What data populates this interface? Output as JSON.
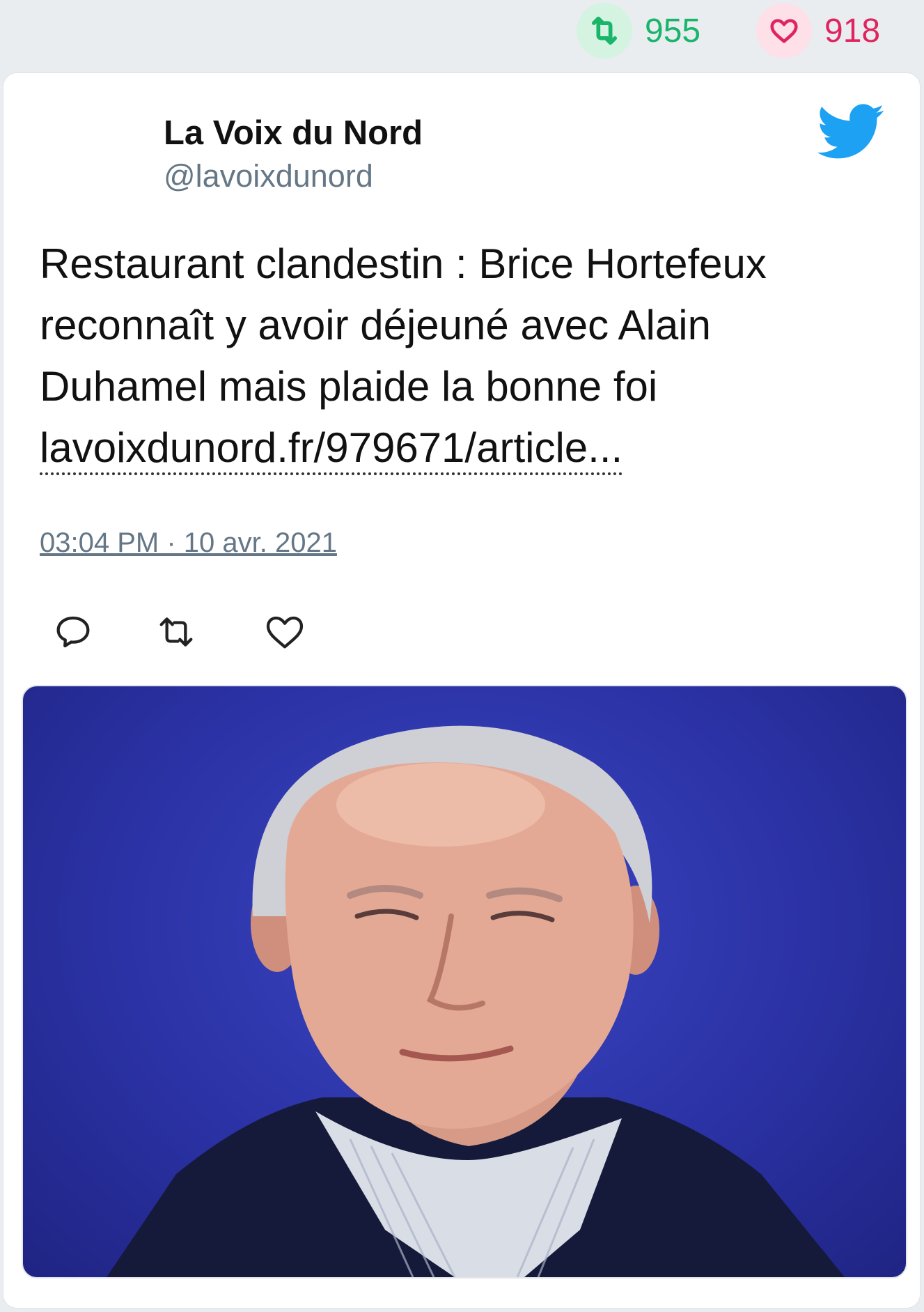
{
  "stats": {
    "retweets": "955",
    "likes": "918",
    "retweet_icon": "retweet-icon",
    "like_icon": "heart-icon",
    "retweet_color": "#18b56a",
    "like_color": "#e0245e"
  },
  "tweet": {
    "author_name": "La Voix du Nord",
    "author_handle": "@lavoixdunord",
    "text": "Restaurant clandestin : Brice Hortefeux reconnaît y avoir déjeuné avec Alain Duhamel mais plaide la bonne foi",
    "link": "lavoixdunord.fr/979671/article...",
    "timestamp": "03:04 PM · 10 avr. 2021",
    "brand_icon": "twitter-bird-icon",
    "brand_color": "#1da1f2",
    "actions": [
      "reply-icon",
      "retweet-icon",
      "like-icon"
    ]
  },
  "media": {
    "kind": "photo"
  }
}
